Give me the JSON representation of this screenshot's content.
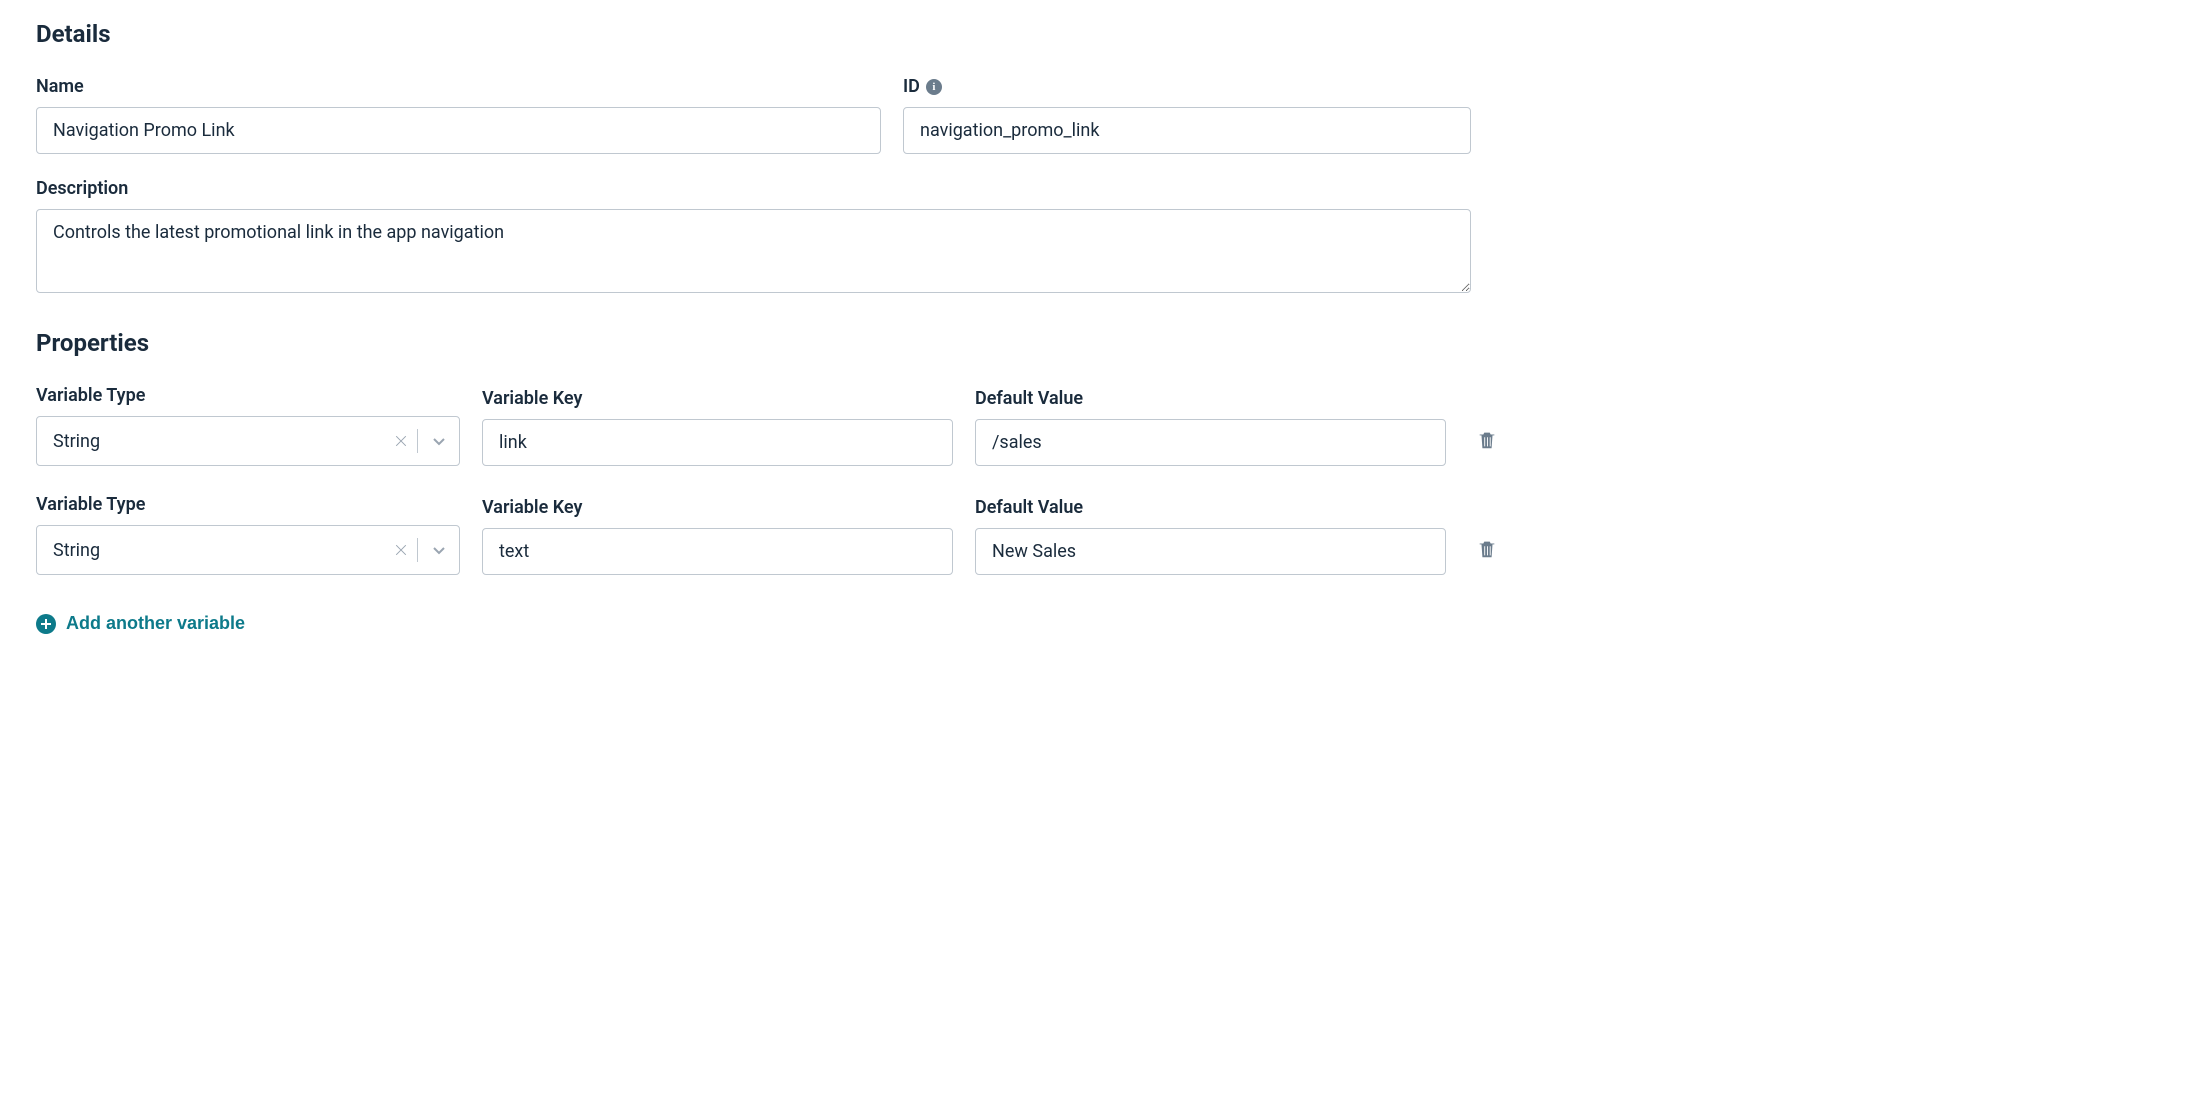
{
  "details": {
    "heading": "Details",
    "name_label": "Name",
    "name_value": "Navigation Promo Link",
    "id_label": "ID",
    "id_value": "navigation_promo_link",
    "description_label": "Description",
    "description_value": "Controls the latest promotional link in the app navigation"
  },
  "properties": {
    "heading": "Properties",
    "type_label": "Variable Type",
    "key_label": "Variable Key",
    "default_label": "Default Value",
    "rows": [
      {
        "type": "String",
        "key": "link",
        "default": "/sales"
      },
      {
        "type": "String",
        "key": "text",
        "default": "New Sales"
      }
    ],
    "add_label": "Add another variable"
  }
}
